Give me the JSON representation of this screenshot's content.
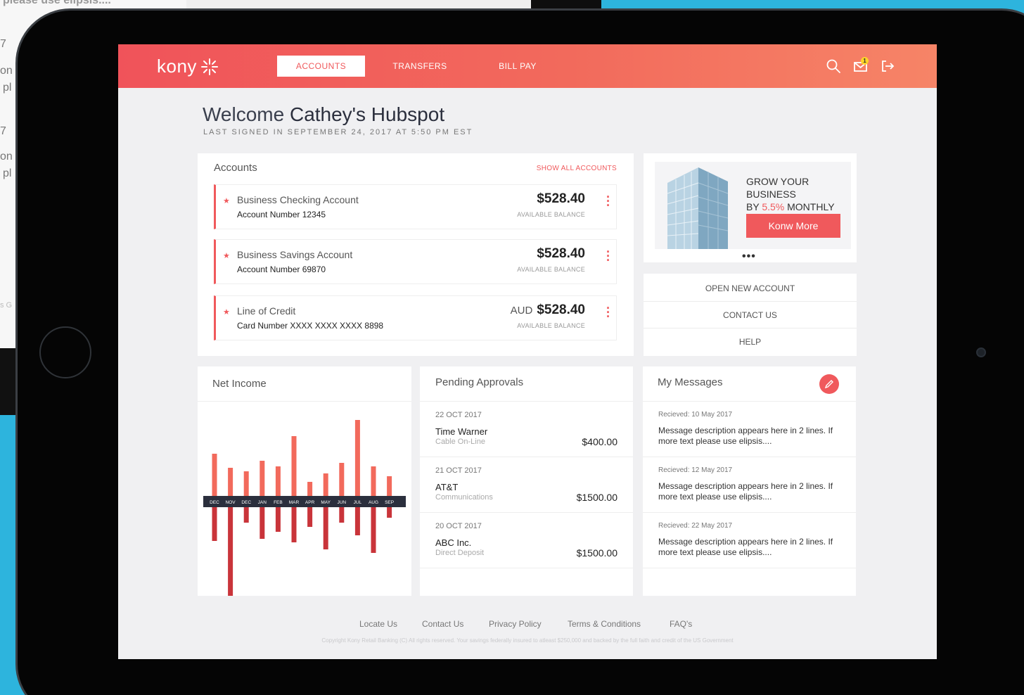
{
  "background": {
    "top_text": "please use elipsis....",
    "fragments": [
      "7",
      "on",
      "pl",
      "7",
      "on",
      "pl",
      "s G"
    ]
  },
  "header": {
    "logo": "kony",
    "nav": [
      {
        "label": "ACCOUNTS",
        "active": true
      },
      {
        "label": "TRANSFERS",
        "active": false
      },
      {
        "label": "BILL PAY",
        "active": false
      }
    ],
    "icons": [
      "search-icon",
      "mail-icon",
      "logout-icon"
    ],
    "notification_badge": "1",
    "accent_color": "#f0595c"
  },
  "welcome": {
    "prefix": "Welcome",
    "name": "Cathey's Hubspot",
    "last_signed": "LAST SIGNED IN SEPTEMBER 24, 2017 AT 5:50 PM EST"
  },
  "accounts": {
    "title": "Accounts",
    "show_all": "SHOW ALL ACCOUNTS",
    "items": [
      {
        "name": "Business Checking Account",
        "number": "Account Number 12345",
        "currency": "",
        "amount": "$528.40",
        "caption": "AVAILABLE BALANCE"
      },
      {
        "name": "Business Savings Account",
        "number": "Account Number 69870",
        "currency": "",
        "amount": "$528.40",
        "caption": "AVAILABLE BALANCE"
      },
      {
        "name": "Line of Credit",
        "number": "Card Number XXXX XXXX XXXX 8898",
        "currency": "AUD",
        "amount": "$528.40",
        "caption": "AVAILABLE BALANCE"
      }
    ]
  },
  "promo": {
    "line1": "GROW YOUR BUSINESS",
    "line2_prefix": "BY ",
    "percent": "5.5%",
    "line2_suffix": " MONTHLY",
    "button": "Konw More",
    "pager": "•••"
  },
  "links": [
    "OPEN NEW ACCOUNT",
    "CONTACT US",
    "HELP"
  ],
  "net_income": {
    "title": "Net Income"
  },
  "chart_data": {
    "type": "bar",
    "categories": [
      "DEC",
      "NOV",
      "DEC",
      "JAN",
      "FEB",
      "MAR",
      "APR",
      "MAY",
      "JUN",
      "JUL",
      "AUG",
      "SEP"
    ],
    "series": [
      {
        "values": [
          60,
          40,
          35,
          50,
          42,
          85,
          20,
          32,
          47,
          108,
          42,
          28
        ]
      },
      {
        "values": [
          -48,
          -135,
          -22,
          -45,
          -35,
          -50,
          -28,
          -60,
          -22,
          -40,
          -65,
          -15
        ]
      }
    ],
    "ylim": [
      -140,
      110
    ],
    "grid": false,
    "colors": [
      "#f26a5c",
      "#c9343a"
    ]
  },
  "pending": {
    "title": "Pending Approvals",
    "items": [
      {
        "date": "22 OCT 2017",
        "name": "Time Warner",
        "sub": "Cable On-Line",
        "amount": "$400.00"
      },
      {
        "date": "21 OCT 2017",
        "name": "AT&T",
        "sub": "Communications",
        "amount": "$1500.00"
      },
      {
        "date": "20 OCT 2017",
        "name": "ABC Inc.",
        "sub": "Direct Deposit",
        "amount": "$1500.00"
      }
    ]
  },
  "messages": {
    "title": "My Messages",
    "items": [
      {
        "date": "Recieved: 10 May 2017",
        "body": "Message description appears here in 2 lines. If more text please use elipsis...."
      },
      {
        "date": "Recieved: 12 May 2017",
        "body": "Message description appears here in 2 lines. If more text please use elipsis...."
      },
      {
        "date": "Recieved: 22 May 2017",
        "body": "Message description appears here in 2 lines. If more text please use elipsis...."
      }
    ]
  },
  "footer": {
    "links": [
      "Locate Us",
      "Contact Us",
      "Privacy Policy",
      "Terms & Conditions",
      "FAQ's"
    ],
    "copyright": "Copyright Kony Retail Banking (C) All rights reserved. Your savings federally insured to atleast $250,000 and backed by the full faith and credit of the US Government"
  }
}
